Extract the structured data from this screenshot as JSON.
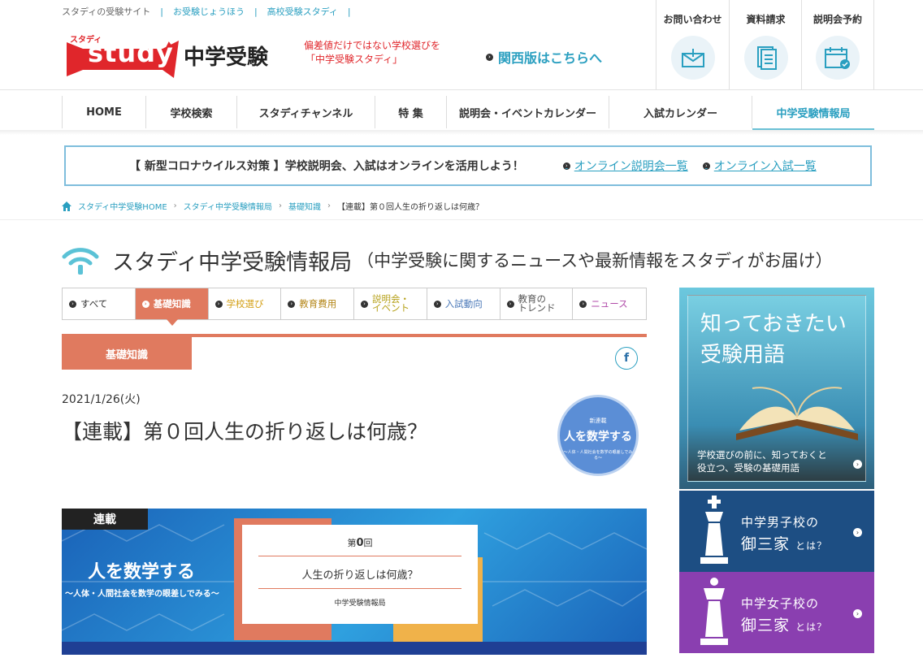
{
  "top_links": [
    "スタディの受験サイト",
    "お受験じょうほう",
    "高校受験スタディ"
  ],
  "logo": {
    "kana": "スタディ",
    "study": "study",
    "chugaku": "中学受験"
  },
  "tagline": [
    "偏差値だけではない学校選びを",
    "「中学受験スタディ」"
  ],
  "kansai_link": "関西版はこちらへ",
  "header_buttons": [
    {
      "label": "お問い合わせ",
      "icon": "mail-icon"
    },
    {
      "label": "資料請求",
      "icon": "document-icon"
    },
    {
      "label": "説明会予約",
      "icon": "calendar-icon"
    }
  ],
  "nav": [
    "HOME",
    "学校検索",
    "スタディチャンネル",
    "特 集",
    "説明会・イベントカレンダー",
    "入試カレンダー",
    "中学受験情報局"
  ],
  "notice": {
    "message": "【 新型コロナウイルス対策 】学校説明会、入試はオンラインを活用しよう！",
    "link1": "オンライン説明会一覧",
    "link2": "オンライン入試一覧"
  },
  "breadcrumb": [
    "スタディ中学受験HOME",
    "スタディ中学受験情報局",
    "基礎知識",
    "【連載】第０回人生の折り返しは何歳？"
  ],
  "section": {
    "title": "スタディ中学受験情報局",
    "subtitle": "（中学受験に関するニュースや最新情報をスタディがお届け）"
  },
  "categories": [
    {
      "label": "すべて",
      "color": "#333333"
    },
    {
      "label": "基礎知識",
      "color": "#ffffff"
    },
    {
      "label": "学校選び",
      "color": "#d4a017"
    },
    {
      "label": "教育費用",
      "color": "#b5881c"
    },
    {
      "label": "説明会・\nイベント",
      "color": "#b7a21c"
    },
    {
      "label": "入試動向",
      "color": "#4a78b8"
    },
    {
      "label": "教育の\nトレンド",
      "color": "#555555"
    },
    {
      "label": "ニュース",
      "color": "#b04aa8"
    }
  ],
  "category_label": "基礎知識",
  "article": {
    "date": "2021/1/26(火)",
    "title": "【連載】第０回人生の折り返しは何歳？",
    "badge": {
      "small": "新連載",
      "main": "人を数学する",
      "sub": "〜人体・人間社会を数学の眼差しでみる〜"
    }
  },
  "hero": {
    "tag": "連載",
    "title": "人を数学する",
    "subtitle": "〜人体・人間社会を数学の眼差しでみる〜",
    "card_prefix": "第",
    "card_num": "0",
    "card_suffix": "回",
    "card_title": "人生の折り返しは何歳？",
    "card_org": "中学受験情報局"
  },
  "sidebar": {
    "glossary": {
      "big1": "知っておきたい",
      "big2": "受験用語",
      "cap1": "学校選びの前に、知っておくと",
      "cap2": "役立つ、受験の基礎用語"
    },
    "boys": {
      "line1": "中学男子校の",
      "line2": "御三家",
      "suffix": "とは？",
      "color": "#1d4e83"
    },
    "girls": {
      "line1": "中学女子校の",
      "line2": "御三家",
      "suffix": "とは？",
      "color": "#8a3fb0"
    }
  }
}
